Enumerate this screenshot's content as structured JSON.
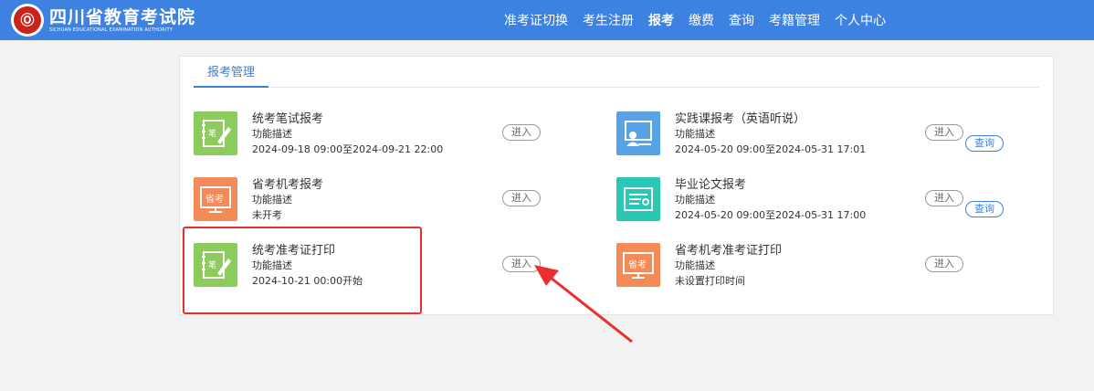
{
  "header": {
    "logo_mark": "Ⓞ",
    "logo_cn": "四川省教育考试院",
    "logo_en": "SICHUAN EDUCATIONAL EXAMINATION AUTHORITY",
    "nav": [
      "准考证切换",
      "考生注册",
      "报考",
      "缴费",
      "查询",
      "考籍管理",
      "个人中心"
    ],
    "active_nav": "报考"
  },
  "panel": {
    "tab_label": "报考管理",
    "enter_label": "进入",
    "query_label": "查询",
    "items": [
      {
        "title": "统考笔试报考",
        "desc": "功能描述",
        "time": "2024-09-18 09:00至2024-09-21 22:00",
        "icon": "notebook-pen-icon",
        "color": "#8ccc5c"
      },
      {
        "title": "实践课报考（英语听说）",
        "desc": "功能描述",
        "time": "2024-05-20 09:00至2024-05-31 17:01",
        "icon": "teacher-board-icon",
        "color": "#5aa2e6"
      },
      {
        "title": "省考机考报考",
        "desc": "功能描述",
        "time": "未开考",
        "icon": "computer-screen-icon",
        "color": "#f38a57"
      },
      {
        "title": "毕业论文报考",
        "desc": "功能描述",
        "time": "2024-05-20 09:00至2024-05-31 17:00",
        "icon": "certificate-icon",
        "color": "#2ac8b4"
      },
      {
        "title": "统考准考证打印",
        "desc": "功能描述",
        "time": "2024-10-21 00:00开始",
        "icon": "notebook-pen-icon",
        "color": "#8ccc5c"
      },
      {
        "title": "省考机考准考证打印",
        "desc": "功能描述",
        "time": "未设置打印时间",
        "icon": "computer-screen-icon",
        "color": "#f38a57"
      }
    ]
  }
}
